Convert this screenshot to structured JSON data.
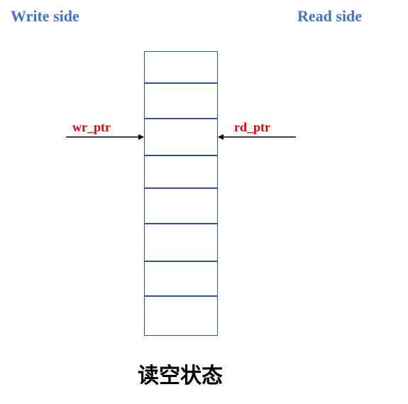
{
  "header": {
    "write_side": "Write side",
    "read_side": "Read side"
  },
  "fifo": {
    "slot_count": 8
  },
  "pointers": {
    "write": "wr_ptr",
    "read": "rd_ptr"
  },
  "caption": "读空状态",
  "colors": {
    "side_label": "#4472c4",
    "fifo_border": "#2f5597",
    "pointer_label": "#e00000",
    "arrow": "#000000"
  }
}
